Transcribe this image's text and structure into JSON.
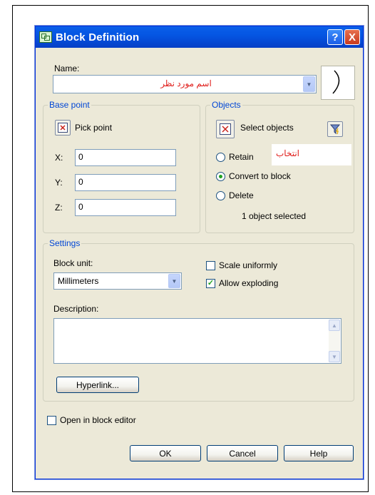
{
  "dialog": {
    "title": "Block Definition",
    "help_button": "?",
    "close_button": "X"
  },
  "name": {
    "label": "Name:",
    "value": "اسم مورد نظر"
  },
  "base_point": {
    "group_label": "Base point",
    "pick_label": "Pick point",
    "x_label": "X:",
    "x_value": "0",
    "y_label": "Y:",
    "y_value": "0",
    "z_label": "Z:",
    "z_value": "0"
  },
  "objects": {
    "group_label": "Objects",
    "select_label": "Select objects",
    "annotation": "انتخاب",
    "retain_label": "Retain",
    "convert_label": "Convert to block",
    "delete_label": "Delete",
    "selected_mode": "Convert to block",
    "status": "1 object selected"
  },
  "settings": {
    "group_label": "Settings",
    "block_unit_label": "Block unit:",
    "block_unit_value": "Millimeters",
    "scale_uniformly_label": "Scale uniformly",
    "scale_uniformly_checked": false,
    "allow_exploding_label": "Allow exploding",
    "allow_exploding_checked": true,
    "description_label": "Description:",
    "description_value": "",
    "hyperlink_label": "Hyperlink..."
  },
  "open_in_editor_label": "Open in block editor",
  "open_in_editor_checked": false,
  "buttons": {
    "ok": "OK",
    "cancel": "Cancel",
    "help": "Help"
  },
  "icons": {
    "app": "block-definition-app-icon",
    "pick": "pick-point-icon",
    "select": "select-objects-icon",
    "filter": "quick-select-filter-icon",
    "preview": "block-preview-icon"
  },
  "colors": {
    "titlebar": "#0556e3",
    "dialog_bg": "#ece9d8",
    "group_title": "#0046d5",
    "annotation_text": "#e0201d"
  }
}
